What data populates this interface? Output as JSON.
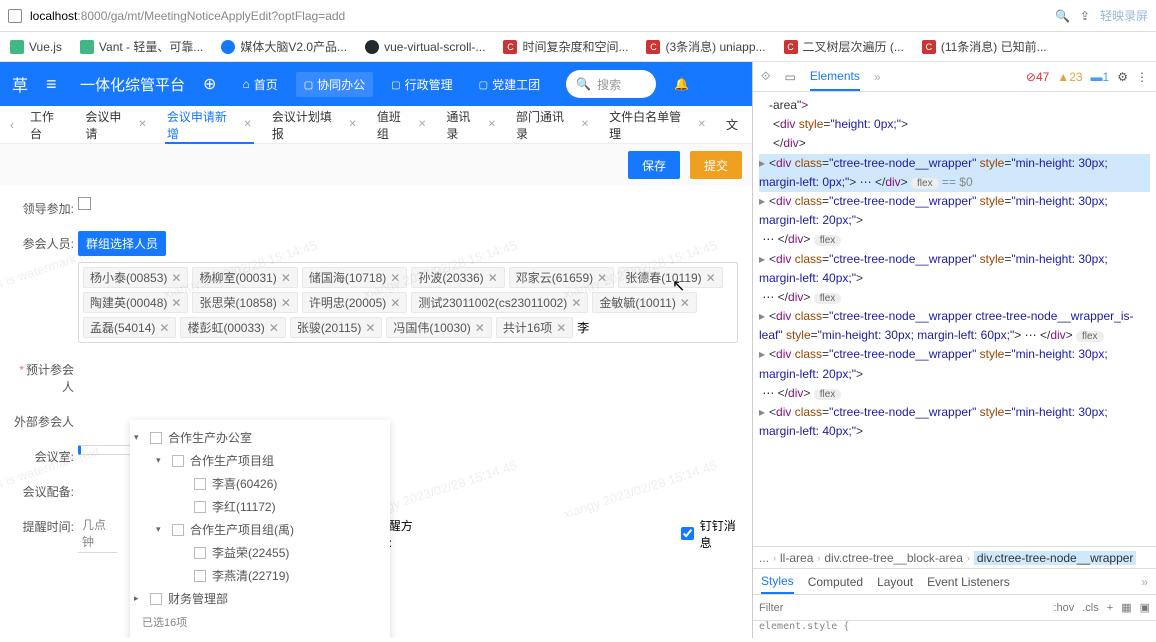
{
  "address": {
    "host": "localhost",
    "port": ":8000",
    "path": "/ga/mt/MeetingNoticeApplyEdit?optFlag=add"
  },
  "watermark_brand": "轻映录屏",
  "bookmarks": [
    {
      "label": "Vue.js"
    },
    {
      "label": "Vant - 轻量、可靠..."
    },
    {
      "label": "媒体大脑V2.0产品..."
    },
    {
      "label": "vue-virtual-scroll-..."
    },
    {
      "label": "时间复杂度和空间..."
    },
    {
      "label": "(3条消息) uniapp..."
    },
    {
      "label": "二叉树层次遍历 (..."
    },
    {
      "label": "(11条消息) 已知前..."
    }
  ],
  "header": {
    "brand": "一体化综管平台",
    "nav": [
      {
        "label": "首页"
      },
      {
        "label": "协同办公"
      },
      {
        "label": "行政管理"
      },
      {
        "label": "党建工团"
      }
    ],
    "search_placeholder": "搜索"
  },
  "tabs": [
    {
      "label": "工作台",
      "closable": false
    },
    {
      "label": "会议申请",
      "closable": true
    },
    {
      "label": "会议申请新增",
      "closable": true,
      "active": true
    },
    {
      "label": "会议计划填报",
      "closable": true
    },
    {
      "label": "值班组",
      "closable": true
    },
    {
      "label": "通讯录",
      "closable": true
    },
    {
      "label": "部门通讯录",
      "closable": true
    },
    {
      "label": "文件白名单管理",
      "closable": true
    },
    {
      "label": "文",
      "closable": false
    }
  ],
  "buttons": {
    "save": "保存",
    "submit": "提交"
  },
  "form": {
    "leader_label": "领导参加:",
    "group_btn": "群组选择人员",
    "participants_label": "参会人员:",
    "estimate_label": "预计参会人",
    "external_label": "外部参会人",
    "room_label": "会议室:",
    "room_placeholder": " ",
    "equip_label": "会议配备:",
    "remind_time_label": "提醒时间:",
    "remind_time_value": "几点钟",
    "remind_way_label": "提醒方式:",
    "dingding_label": "钉钉消息"
  },
  "tags": [
    "杨小泰(00853)",
    "杨柳室(00031)",
    "储国海(10718)",
    "孙波(20336)",
    "邓家云(61659)",
    "张德春(10119)",
    "陶建英(00048)",
    "张思荣(10858)",
    "许明忠(20005)",
    "测试23011002(cs23011002)",
    "金敏毓(10011)",
    "孟磊(54014)",
    "楼彭虹(00033)",
    "张骏(20115)",
    "冯国伟(10030)",
    "共计16项"
  ],
  "tag_input": "李",
  "tree": {
    "count": "已选16项",
    "nodes": [
      {
        "level": 1,
        "arrow": "▾",
        "check": true,
        "label": "合作生产办公室"
      },
      {
        "level": 2,
        "arrow": "▾",
        "check": true,
        "label": "合作生产项目组"
      },
      {
        "level": 3,
        "arrow": "",
        "check": true,
        "label": "李喜(60426)"
      },
      {
        "level": 3,
        "arrow": "",
        "check": true,
        "label": "李红(11172)"
      },
      {
        "level": 2,
        "arrow": "▾",
        "check": true,
        "label": "合作生产项目组(禹)"
      },
      {
        "level": 3,
        "arrow": "",
        "check": true,
        "label": "李益荣(22455)"
      },
      {
        "level": 3,
        "arrow": "",
        "check": true,
        "label": "李燕清(22719)"
      },
      {
        "level": 1,
        "arrow": "▸",
        "check": true,
        "label": "财务管理部"
      }
    ]
  },
  "dev": {
    "tab": "Elements",
    "counts": {
      "err": "47",
      "warn": "23",
      "info": "1"
    },
    "crumbs": [
      "...",
      "ll-area",
      "div.ctree-tree__block-area",
      "div.ctree-tree-node__wrapper"
    ],
    "styles_tabs": [
      "Styles",
      "Computed",
      "Layout",
      "Event Listeners"
    ],
    "filter_placeholder": "Filter",
    "hov": ":hov",
    "cls": ".cls",
    "elem_start": "element.style {"
  },
  "watermark": "xiangy 2023/02/28 15:14:45",
  "watermark_short": "this is watermark text"
}
